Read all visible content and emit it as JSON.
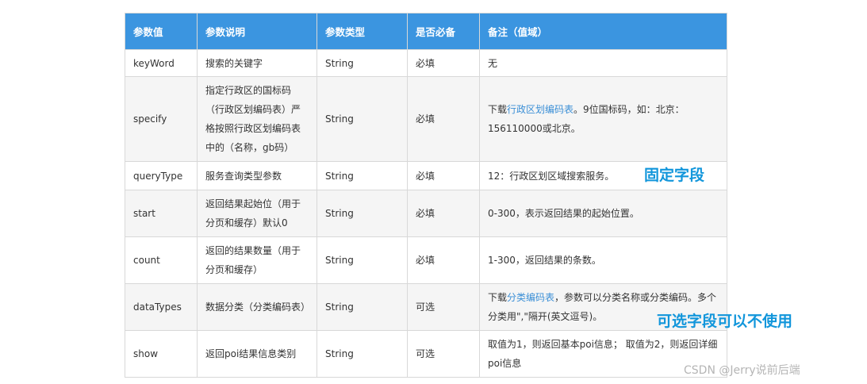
{
  "table": {
    "headers": [
      "参数值",
      "参数说明",
      "参数类型",
      "是否必备",
      "备注（值域）"
    ],
    "rows": [
      {
        "name": "keyWord",
        "desc": "搜索的关键字",
        "type": "String",
        "required": "必填",
        "note": "无"
      },
      {
        "name": "specify",
        "desc": "指定行政区的国标码（行政区划编码表）严格按照行政区划编码表中的（名称，gb码）",
        "type": "String",
        "required": "必填",
        "note_prefix": "下载",
        "note_link": "行政区划编码表",
        "note_suffix": "。9位国标码，如：北京：156110000或北京。"
      },
      {
        "name": "queryType",
        "desc": "服务查询类型参数",
        "type": "String",
        "required": "必填",
        "note": "12：行政区划区域搜索服务。"
      },
      {
        "name": "start",
        "desc": "返回结果起始位（用于分页和缓存）默认0",
        "type": "String",
        "required": "必填",
        "note": "0-300，表示返回结果的起始位置。"
      },
      {
        "name": "count",
        "desc": "返回的结果数量（用于分页和缓存）",
        "type": "String",
        "required": "必填",
        "note": "1-300，返回结果的条数。"
      },
      {
        "name": "dataTypes",
        "desc": "数据分类（分类编码表）",
        "type": "String",
        "required": "可选",
        "note_prefix": "下载",
        "note_link": "分类编码表",
        "note_suffix": "，参数可以分类名称或分类编码。多个分类用\",\"隔开(英文逗号)。"
      },
      {
        "name": "show",
        "desc": "返回poi结果信息类别",
        "type": "String",
        "required": "可选",
        "note": "取值为1，则返回基本poi信息； 取值为2，则返回详细poi信息"
      }
    ]
  },
  "annotations": {
    "fixed": "固定字段",
    "optional": "可选字段可以不使用"
  },
  "watermark": "CSDN @Jerry说前后端",
  "colors": {
    "header_bg": "#3b95e0",
    "link": "#3b8fd6",
    "annotation": "#1296db"
  }
}
